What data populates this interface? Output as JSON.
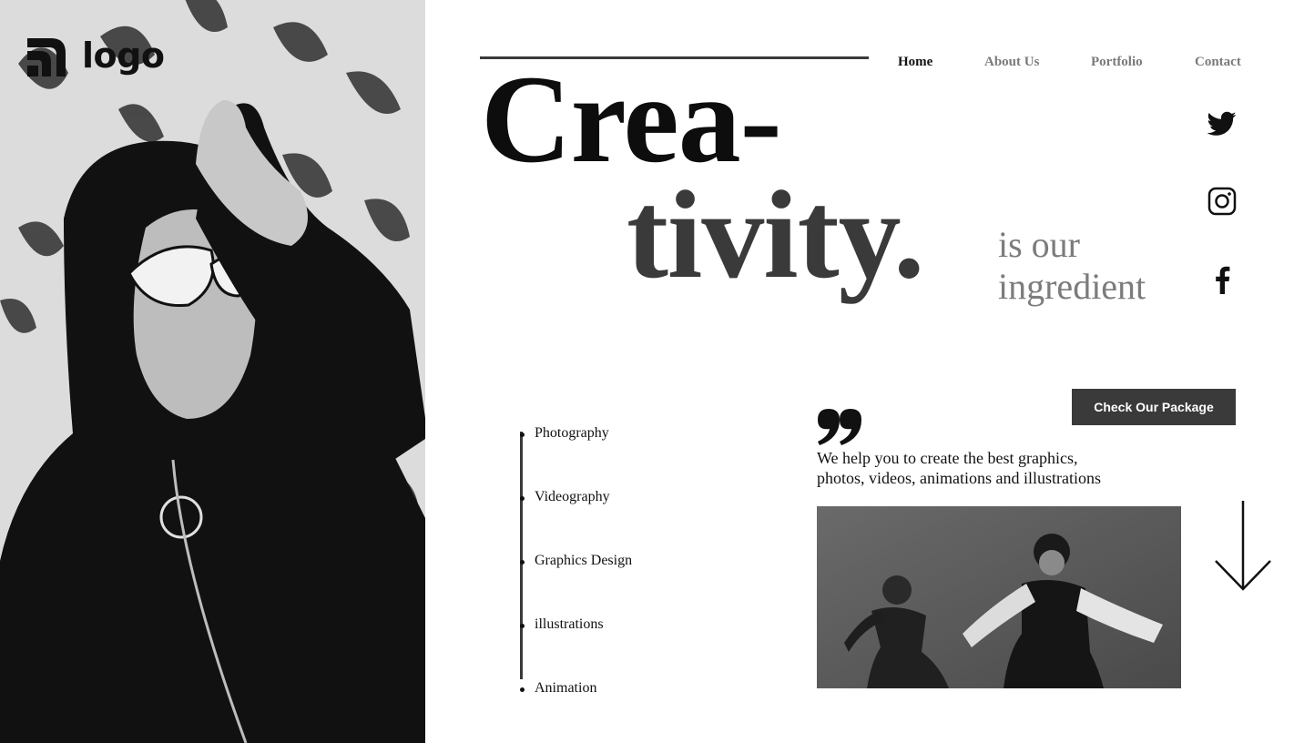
{
  "brand": {
    "logo_text": "logo",
    "logo_icon": "signal-waves-icon"
  },
  "nav": {
    "items": [
      {
        "label": "Home",
        "active": true
      },
      {
        "label": "About Us",
        "active": false
      },
      {
        "label": "Portfolio",
        "active": false
      },
      {
        "label": "Contact",
        "active": false
      }
    ]
  },
  "hero": {
    "headline_line1": "Crea-",
    "headline_line2": "tivity.",
    "subhead_line1": "is our",
    "subhead_line2": "ingredient",
    "photo": "woman-in-white-sunglasses-photo"
  },
  "social": [
    {
      "name": "twitter-icon"
    },
    {
      "name": "instagram-icon"
    },
    {
      "name": "facebook-icon"
    }
  ],
  "cta": {
    "label": "Check Our Package"
  },
  "services": {
    "items": [
      "Photography",
      "Videography",
      "Graphics Design",
      "illustrations",
      "Animation"
    ]
  },
  "quote": {
    "icon": "quote-mark-icon",
    "line1": "We help you to create the best graphics,",
    "line2": "photos, videos, animations and illustrations"
  },
  "media": {
    "dance_photo": "dancers-photo",
    "scroll_icon": "arrow-down-icon"
  },
  "colors": {
    "text_dark": "#0d0d0d",
    "text_grey": "#7a7a7a",
    "accent_dark": "#3a3a3a",
    "background": "#ffffff"
  }
}
